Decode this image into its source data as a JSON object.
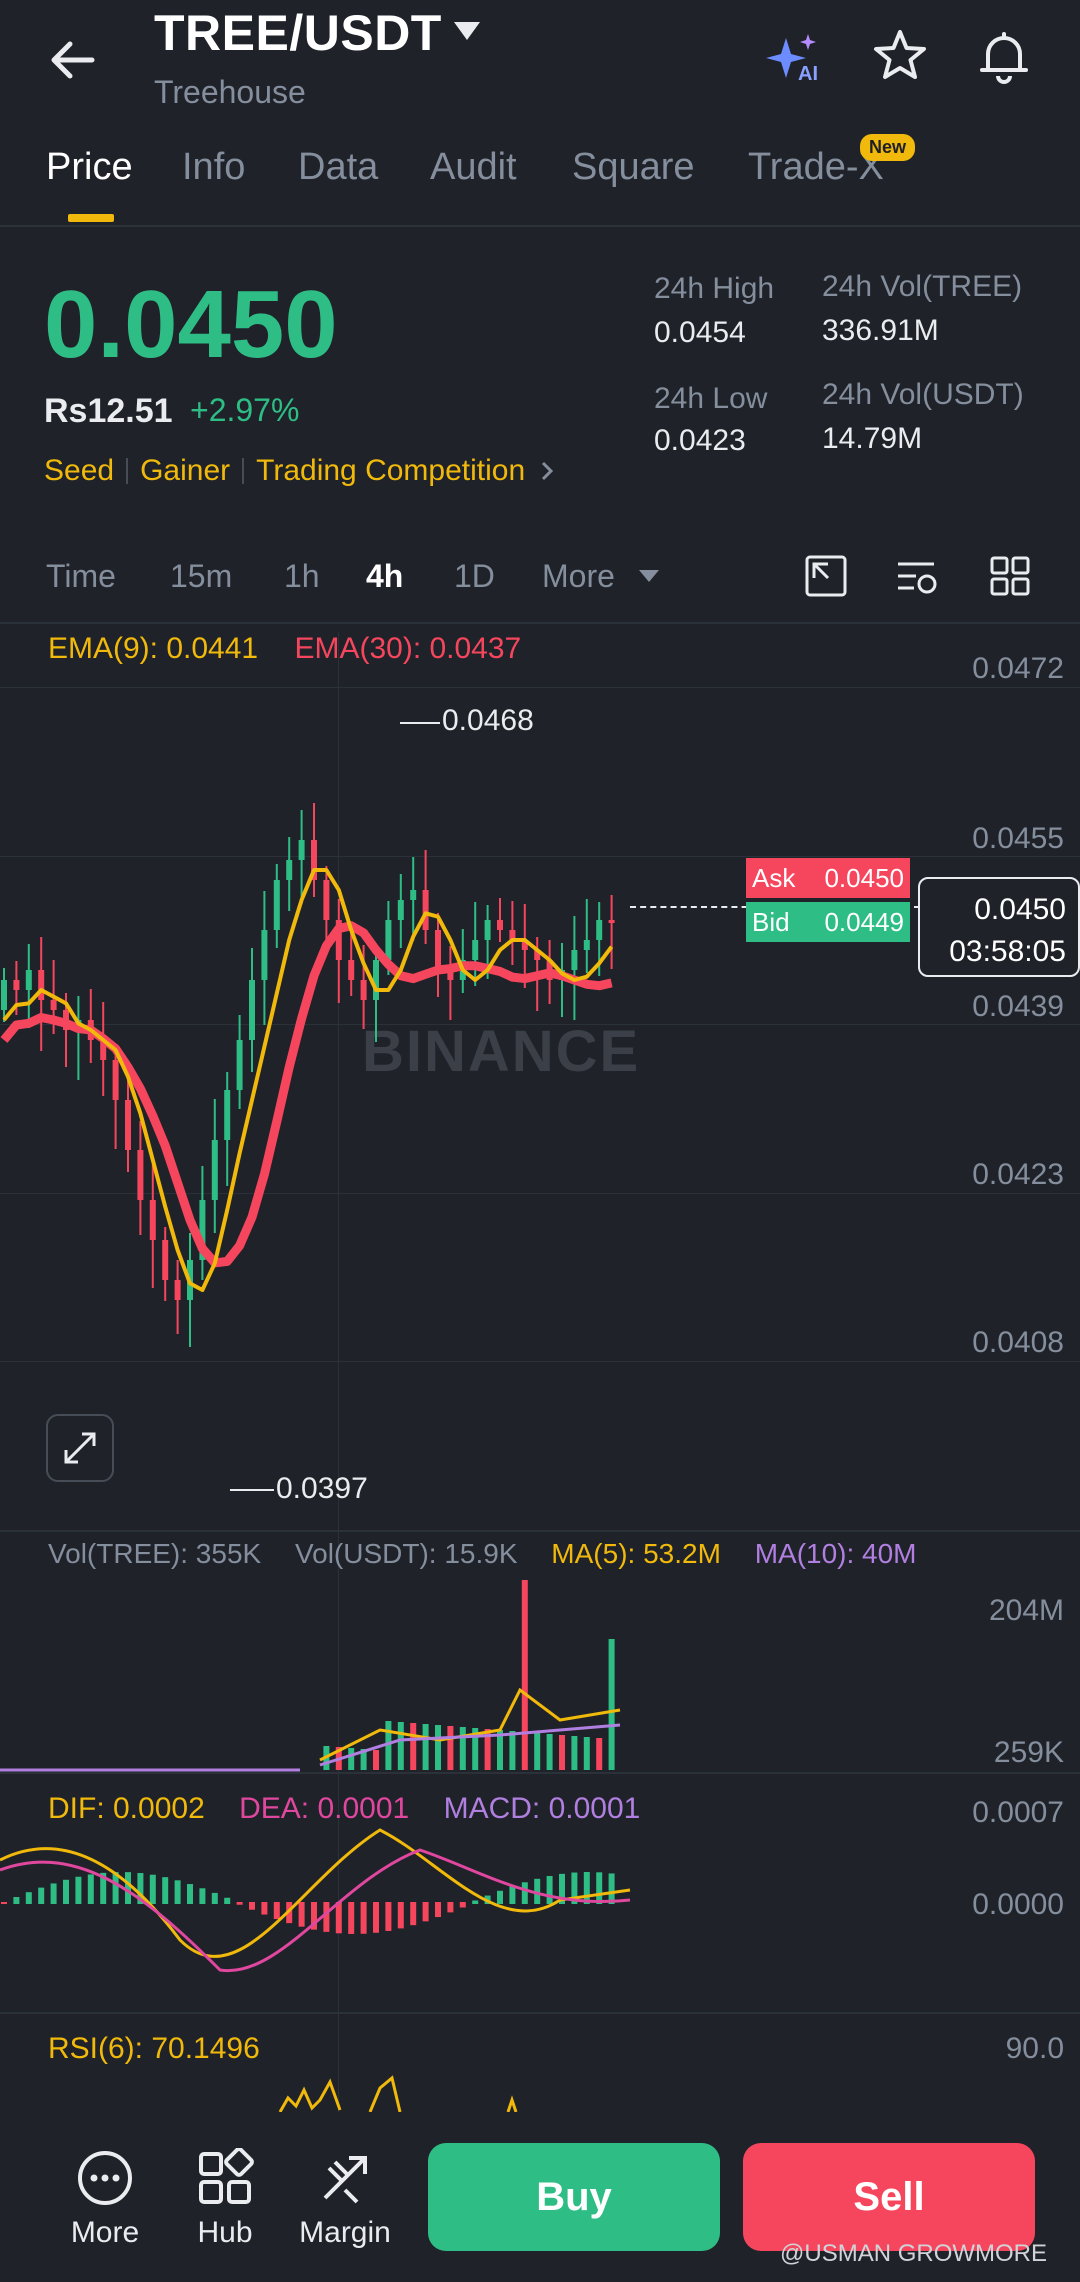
{
  "header": {
    "pair": "TREE/USDT",
    "subtitle": "Treehouse",
    "icons": [
      "back-arrow-icon",
      "ai-sparkle-icon",
      "star-icon",
      "bell-icon"
    ]
  },
  "tabs": [
    {
      "label": "Price",
      "active": true
    },
    {
      "label": "Info"
    },
    {
      "label": "Data"
    },
    {
      "label": "Audit"
    },
    {
      "label": "Square"
    },
    {
      "label": "Trade-X",
      "badge": "New"
    }
  ],
  "price": {
    "last": "0.0450",
    "fiat": "Rs12.51",
    "change": "+2.97%",
    "tags": [
      "Seed",
      "Gainer",
      "Trading Competition"
    ]
  },
  "stats": {
    "high_label": "24h High",
    "high": "0.0454",
    "low_label": "24h Low",
    "low": "0.0423",
    "vol_tree_label": "24h Vol(TREE)",
    "vol_tree": "336.91M",
    "vol_usdt_label": "24h Vol(USDT)",
    "vol_usdt": "14.79M"
  },
  "timeframes": [
    {
      "label": "Time"
    },
    {
      "label": "15m"
    },
    {
      "label": "1h"
    },
    {
      "label": "4h",
      "active": true
    },
    {
      "label": "1D"
    },
    {
      "label": "More"
    }
  ],
  "chart": {
    "ema9": "EMA(9): 0.0441",
    "ema30": "EMA(30): 0.0437",
    "y_ticks": [
      "0.0472",
      "0.0455",
      "0.0439",
      "0.0423",
      "0.0408"
    ],
    "high_marker": "0.0468",
    "low_marker": "0.0397",
    "ask_label": "Ask",
    "ask": "0.0450",
    "bid_label": "Bid",
    "bid": "0.0449",
    "last_price": "0.0450",
    "countdown": "03:58:05",
    "watermark": "BINANCE",
    "colors": {
      "up": "#2ebd85",
      "down": "#f6465d",
      "ema9": "#f0b90b",
      "ema30": "#f6465d"
    }
  },
  "volume": {
    "vol_tree": "Vol(TREE): 355K",
    "vol_usdt": "Vol(USDT): 15.9K",
    "ma5": "MA(5): 53.2M",
    "ma10": "MA(10): 40M",
    "y_top": "204M",
    "y_bottom": "259K"
  },
  "macd": {
    "dif": "DIF: 0.0002",
    "dea": "DEA: 0.0001",
    "macd": "MACD: 0.0001",
    "y_top": "0.0007",
    "y_zero": "0.0000"
  },
  "rsi": {
    "label": "RSI(6): 70.1496",
    "y_top": "90.0"
  },
  "bottom_nav": [
    {
      "label": "More",
      "icon": "more-dots-icon"
    },
    {
      "label": "Hub",
      "icon": "hub-grid-icon"
    },
    {
      "label": "Margin",
      "icon": "margin-arrows-icon"
    }
  ],
  "actions": {
    "buy": "Buy",
    "sell": "Sell"
  },
  "credit": "@USMAN GROWMORE"
}
